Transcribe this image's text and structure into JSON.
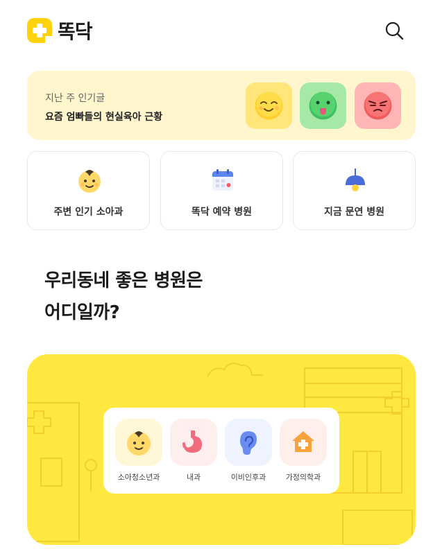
{
  "header": {
    "logo_text": "똑닥",
    "brand_color": "#FFD20E"
  },
  "popular": {
    "subtitle": "지난 주 인기글",
    "title": "요즘 엄빠들의 현실육아 근황",
    "emojis": [
      "smiling-face-icon",
      "sick-face-icon",
      "annoyed-face-icon"
    ]
  },
  "menu": [
    {
      "label": "주변 인기 소아과",
      "icon": "baby-face-icon"
    },
    {
      "label": "똑닥 예약 병원",
      "icon": "calendar-icon"
    },
    {
      "label": "지금 문연 병원",
      "icon": "lamp-icon"
    }
  ],
  "headline": {
    "line1": "우리동네 좋은 병원은",
    "line2": "어디일까?"
  },
  "departments": [
    {
      "label": "소아청소년과",
      "icon": "baby-face-icon"
    },
    {
      "label": "내과",
      "icon": "stomach-icon"
    },
    {
      "label": "이비인후과",
      "icon": "ear-icon"
    },
    {
      "label": "가정의학과",
      "icon": "house-medical-icon"
    }
  ]
}
